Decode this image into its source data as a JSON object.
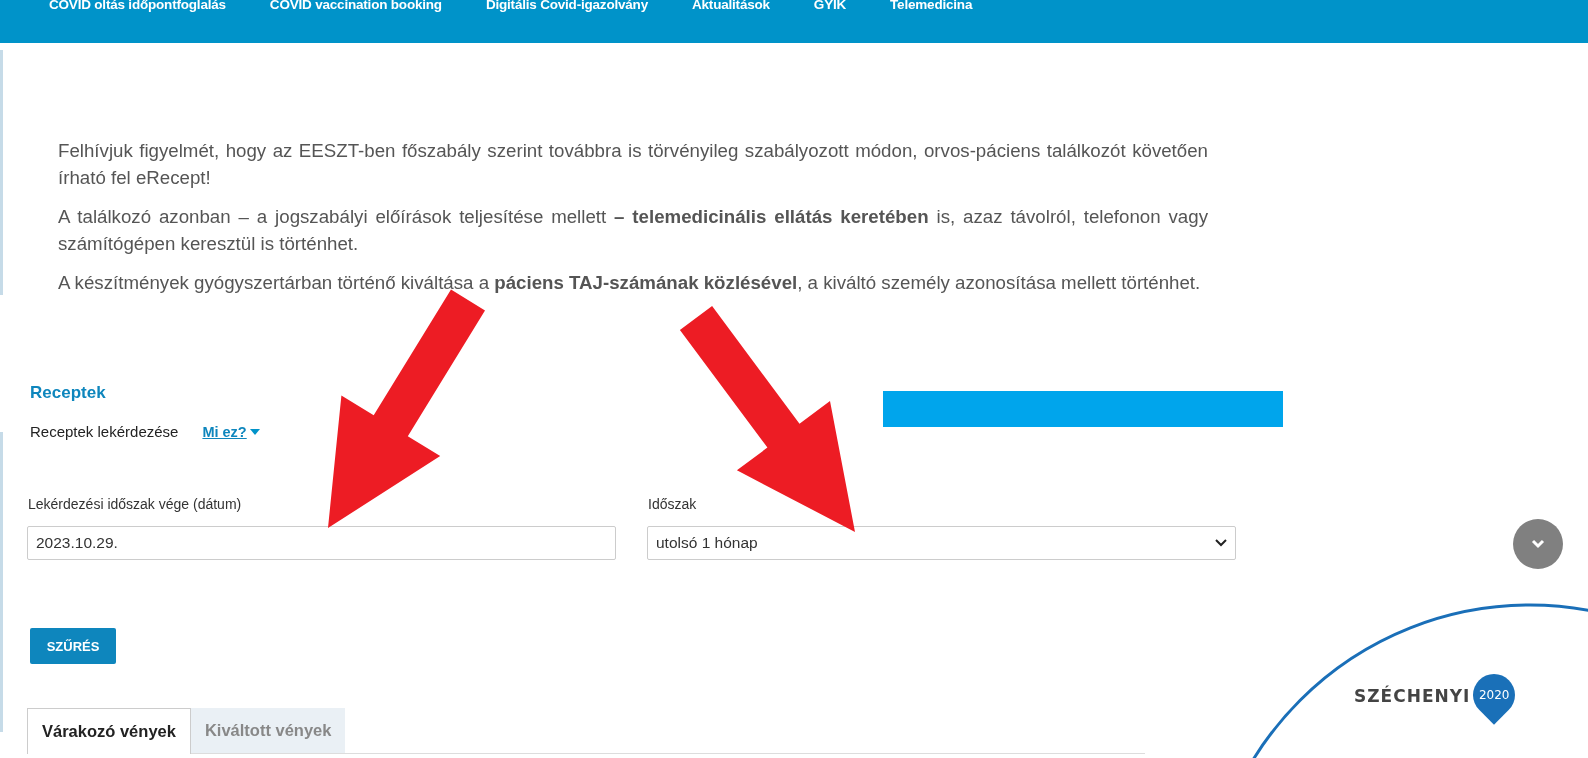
{
  "nav": [
    "COVID oltás időpontfoglalás",
    "COVID vaccination booking",
    "Digitális Covid-igazolvány",
    "Aktualitások",
    "GYIK",
    "Telemedicina"
  ],
  "notice": [
    "Felhívjuk figyelmét, hogy az EESZT-ben főszabály szerint továbbra is törvényileg szabályozott módon, orvos-páciens találkozót követően írható fel eRecept!",
    "A találkozó azonban – a jogszabályi előírások teljesítése mellett **– telemedicinális ellátás keretében** is, azaz távolról, telefonon vagy számítógépen keresztül is történhet.",
    "A készítmények gyógyszertárban történő kiváltása a **páciens TAJ-számának közlésével**, a kiváltó személy azonosítása mellett történhet."
  ],
  "section": {
    "title": "Receptek",
    "subtitle": "Receptek lekérdezése",
    "help_link": "Mi ez?"
  },
  "fields": [
    {
      "kind": "text",
      "label": "Lekérdezési időszak vége (dátum)",
      "value": "2023.10.29."
    },
    {
      "kind": "select",
      "label": "Időszak",
      "value": "utolsó 1 hónap"
    }
  ],
  "filter_button": "SZŰRÉS",
  "tabs": [
    {
      "label": "Várakozó vények",
      "selected": true
    },
    {
      "label": "Kiváltott vények",
      "selected": false
    }
  ],
  "logo": {
    "name": "SZÉCHENYI",
    "year": "2020"
  }
}
